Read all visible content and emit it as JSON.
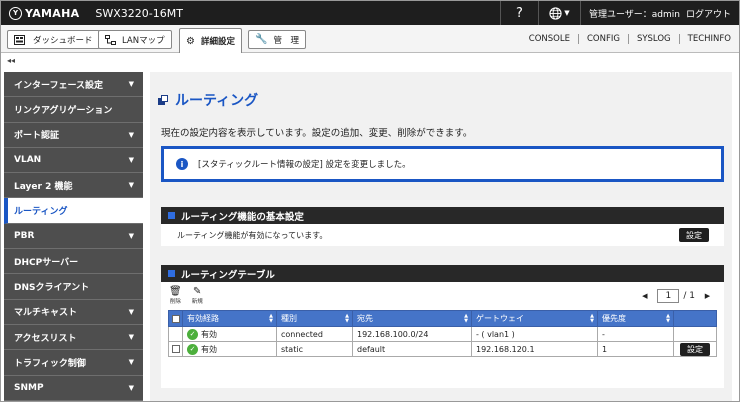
{
  "header": {
    "logo_mark": "Y",
    "logo_text": "YAMAHA",
    "model": "SWX3220-16MT",
    "help": "?",
    "language_icon": "globe-icon",
    "user_label": "管理ユーザー：admin",
    "logout": "ログアウト"
  },
  "tabs": [
    {
      "label": "ダッシュボード",
      "icon": "dashboard-icon"
    },
    {
      "label": "LANマップ",
      "icon": "lan-map-icon"
    },
    {
      "label": "詳細設定",
      "icon": "gear-icon"
    },
    {
      "label": "管　理",
      "icon": "wrench-icon"
    }
  ],
  "links": [
    "CONSOLE",
    "CONFIG",
    "SYSLOG",
    "TECHINFO"
  ],
  "collapse_label": "◂◂",
  "sidebar": [
    {
      "label": "インターフェース設定",
      "chev": true
    },
    {
      "label": "リンクアグリゲーション",
      "chev": false
    },
    {
      "label": "ポート認証",
      "chev": true
    },
    {
      "label": "VLAN",
      "chev": true
    },
    {
      "label": "Layer 2 機能",
      "chev": true
    },
    {
      "label": "ルーティング",
      "chev": false,
      "active": true
    },
    {
      "label": "PBR",
      "chev": true
    },
    {
      "label": "DHCPサーバー",
      "chev": false
    },
    {
      "label": "DNSクライアント",
      "chev": false
    },
    {
      "label": "マルチキャスト",
      "chev": true
    },
    {
      "label": "アクセスリスト",
      "chev": true
    },
    {
      "label": "トラフィック制御",
      "chev": true
    },
    {
      "label": "SNMP",
      "chev": true
    }
  ],
  "page": {
    "title": "ルーティング",
    "description": "現在の設定内容を表示しています。設定の追加、変更、削除ができます。",
    "notice": "[スタティックルート情報の設定] 設定を変更しました。"
  },
  "basic": {
    "title": "ルーティング機能の基本設定",
    "status_text": "ルーティング機能が有効になっています。",
    "button": "設定"
  },
  "table_section": {
    "title": "ルーティングテーブル",
    "delete_label": "削除",
    "new_label": "新規",
    "page_current": "1",
    "page_total": "/ 1",
    "columns": [
      "有効経路",
      "種別",
      "宛先",
      "ゲートウェイ",
      "優先度"
    ],
    "rows": [
      {
        "valid": "有効",
        "type": "connected",
        "dest": "192.168.100.0/24",
        "gateway": "- ( vlan1 )",
        "priority": "-",
        "has_checkbox": false,
        "button": ""
      },
      {
        "valid": "有効",
        "type": "static",
        "dest": "default",
        "gateway": "192.168.120.1",
        "priority": "1",
        "has_checkbox": true,
        "button": "設定"
      }
    ]
  },
  "colors": {
    "accent": "#1a56c4",
    "sidebar": "#4e4e4e",
    "table_header": "#4574c8",
    "ok": "#4caf3c"
  }
}
